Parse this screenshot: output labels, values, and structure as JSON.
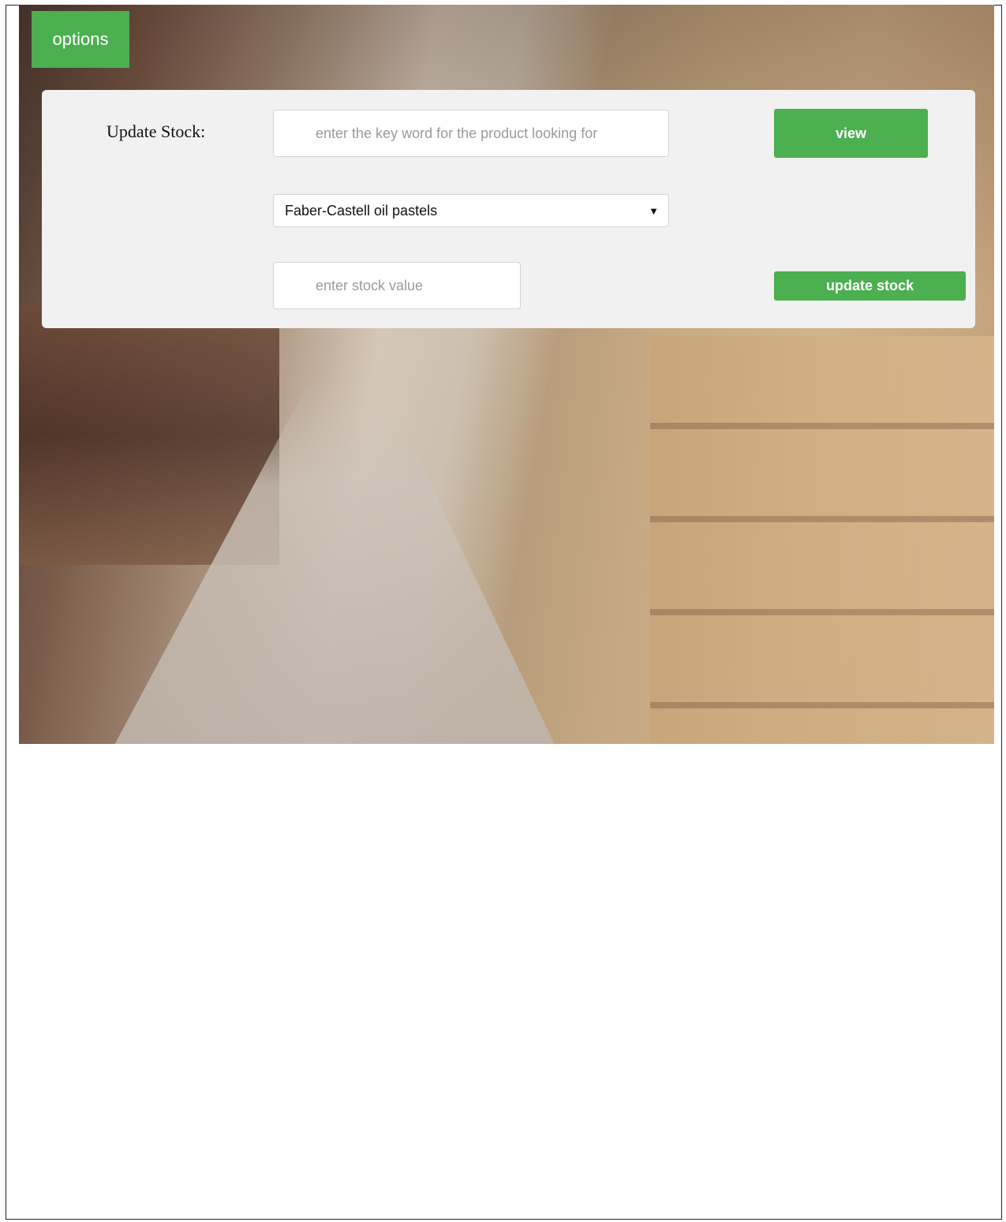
{
  "header": {
    "options_label": "options"
  },
  "update_panel": {
    "label": "Update Stock:",
    "keyword_placeholder": "enter the key word for the product looking for",
    "view_label": "view",
    "product_selected": "Faber-Castell oil pastels",
    "stock_placeholder": "enter stock value",
    "update_label": "update stock"
  },
  "colors": {
    "accent": "#4caf50",
    "panel": "#f1f1f1"
  },
  "icons": {
    "select_caret": "chevron-down-icon"
  }
}
